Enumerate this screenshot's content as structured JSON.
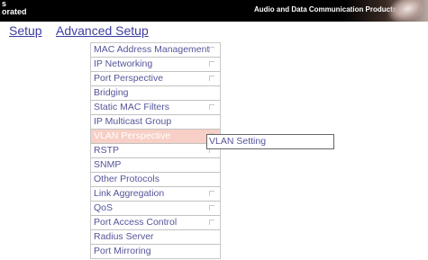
{
  "banner": {
    "company_line1": "s",
    "company_line2": "orated",
    "tagline": "Audio and Data Communication Products"
  },
  "nav": {
    "setup": "Setup",
    "advanced_setup": "Advanced Setup"
  },
  "menu": {
    "items": [
      {
        "label": "MAC Address Management",
        "has_submenu": true
      },
      {
        "label": "IP Networking",
        "has_submenu": true
      },
      {
        "label": "Port Perspective",
        "has_submenu": true
      },
      {
        "label": "Bridging",
        "has_submenu": false
      },
      {
        "label": "Static MAC Filters",
        "has_submenu": true
      },
      {
        "label": "IP Multicast Group",
        "has_submenu": false
      },
      {
        "label": "VLAN Perspective",
        "has_submenu": true,
        "active": true
      },
      {
        "label": "RSTP",
        "has_submenu": true
      },
      {
        "label": "SNMP",
        "has_submenu": false
      },
      {
        "label": "Other Protocols",
        "has_submenu": false
      },
      {
        "label": "Link Aggregation",
        "has_submenu": true
      },
      {
        "label": "QoS",
        "has_submenu": true
      },
      {
        "label": "Port Access Control",
        "has_submenu": true
      },
      {
        "label": "Radius Server",
        "has_submenu": false
      },
      {
        "label": "Port Mirroring",
        "has_submenu": false
      }
    ]
  },
  "submenu": {
    "items": [
      {
        "label": "VLAN Setting"
      }
    ]
  },
  "colors": {
    "link": "#3d3da0",
    "menu_text": "#55559b",
    "active_bg": "#f7cfc6"
  }
}
